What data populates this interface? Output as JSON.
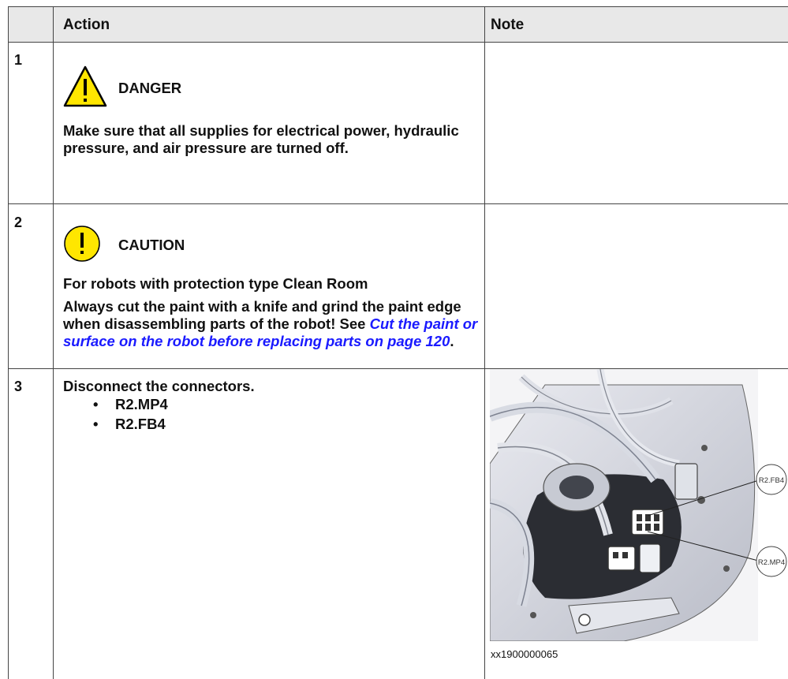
{
  "table": {
    "headers": {
      "action": "Action",
      "note": "Note"
    },
    "rows": [
      {
        "step": "1",
        "signal_word": "DANGER",
        "text": "Make sure that all supplies for electrical power, hydraulic pressure, and air pressure are turned off."
      },
      {
        "step": "2",
        "signal_word": "CAUTION",
        "heading": "For robots with protection type Clean Room",
        "text_before_link": "Always cut the paint with a knife and grind the paint edge when disassembling parts of the robot! See ",
        "link_text": "Cut the paint or surface on the robot before replacing parts on page 120",
        "text_after_link": "."
      },
      {
        "step": "3",
        "text": "Disconnect the connectors.",
        "bullets": [
          "R2.MP4",
          "R2.FB4"
        ],
        "figure_callouts": [
          "R2.FB4",
          "R2.MP4"
        ],
        "figure_caption": "xx1900000065"
      }
    ]
  }
}
